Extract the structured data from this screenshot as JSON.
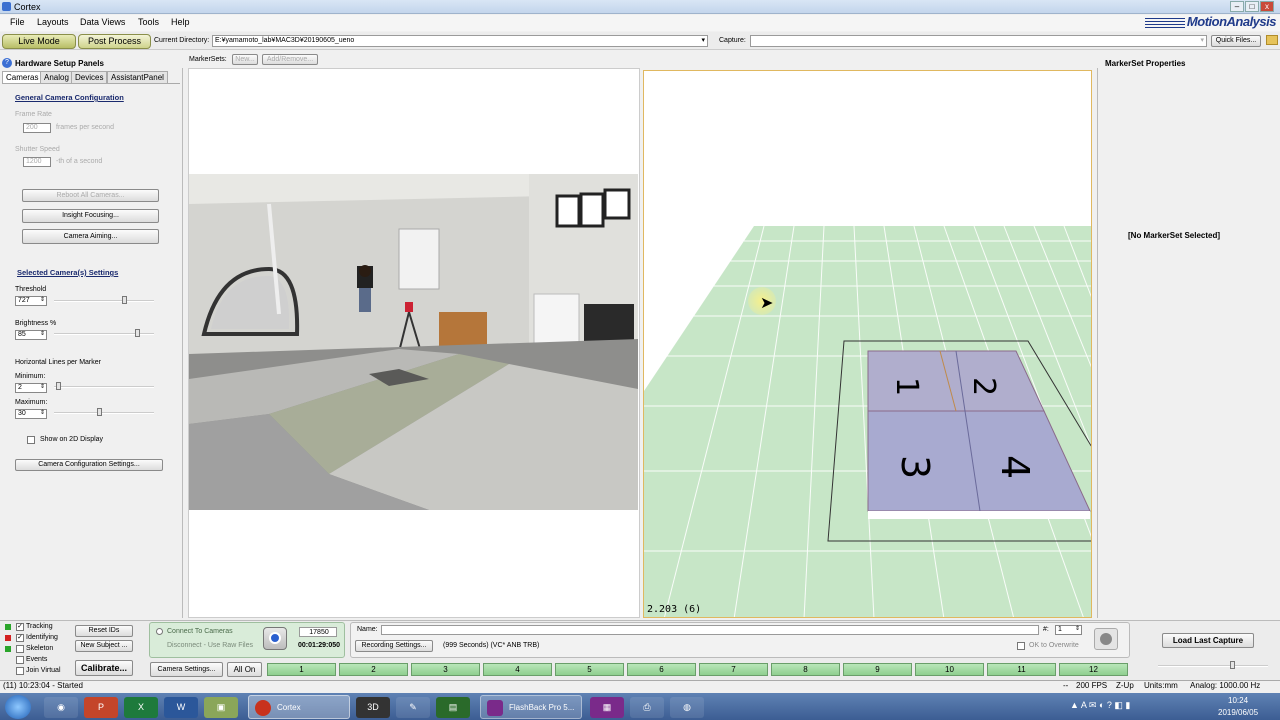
{
  "window": {
    "title": "Cortex",
    "brand": "MotionAnalysis"
  },
  "menu": [
    "File",
    "Layouts",
    "Data Views",
    "Tools",
    "Help"
  ],
  "toolbar": {
    "live_mode": "Live Mode",
    "post_process": "Post Process",
    "current_dir_label": "Current Directory:",
    "current_dir_value": "E:¥yamamoto_lab¥MAC3D¥20190605_ueno",
    "capture_label": "Capture:",
    "capture_value": "",
    "quick_files": "Quick Files..."
  },
  "markersets": {
    "label": "MarkerSets:",
    "new": "New...",
    "add_remove": "Add/Remove..."
  },
  "left": {
    "panel_title": "Hardware Setup Panels",
    "tabs": [
      "Cameras",
      "Analog",
      "Devices",
      "AssistantPanel"
    ],
    "general_title": "General Camera Configuration",
    "frame_rate_label": "Frame Rate",
    "frame_rate_value": "200",
    "frame_rate_unit": "frames per second",
    "shutter_label": "Shutter Speed",
    "shutter_value": "1200",
    "shutter_unit": "-th of a second",
    "reboot": "Reboot All Cameras...",
    "insight": "Insight Focusing...",
    "aiming": "Camera Aiming...",
    "selected_title": "Selected Camera(s) Settings",
    "threshold_label": "Threshold",
    "threshold_value": "727",
    "brightness_label": "Brightness %",
    "brightness_value": "85",
    "hlines_label": "Horizontal Lines per Marker",
    "min_label": "Minimum:",
    "min_value": "2",
    "max_label": "Maximum:",
    "max_value": "30",
    "show2d": "Show on 2D Display",
    "config_settings": "Camera Configuration Settings..."
  },
  "sliders": {
    "threshold": 0.72,
    "brightness": 0.85,
    "minimum": 0.02,
    "maximum": 0.45
  },
  "view3d": {
    "readout": "2.203 (6)",
    "plates": [
      "1",
      "2",
      "3",
      "4"
    ]
  },
  "right": {
    "title": "MarkerSet Properties",
    "empty": "[No MarkerSet Selected]"
  },
  "bottom": {
    "checks": [
      {
        "label": "Tracking",
        "checked": true,
        "color": "#2aa52a"
      },
      {
        "label": "Identifying",
        "checked": true,
        "color": "#d32020"
      },
      {
        "label": "Skeleton",
        "checked": false,
        "color": "#2aa52a"
      },
      {
        "label": "Events",
        "checked": false,
        "color": ""
      },
      {
        "label": "Join Virtual",
        "checked": false,
        "color": ""
      }
    ],
    "reset_ids": "Reset IDs",
    "new_subject": "New Subject ...",
    "calibrate": "Calibrate...",
    "connect": "Connect To Cameras",
    "disconnect": "Disconnect - Use Raw Files",
    "frame_count": "17850",
    "timecode": "00:01:29:050",
    "name_label": "Name:",
    "name_value": "",
    "hash_label": "#:",
    "hash_value": "1",
    "recording_settings": "Recording Settings...",
    "recording_info": "(999 Seconds) (VC* ANB TRB)",
    "ok_overwrite": "OK to Overwrite",
    "load_last": "Load Last Capture",
    "camera_settings": "Camera Settings...",
    "all_on": "All On",
    "cameras": [
      "1",
      "2",
      "3",
      "4",
      "5",
      "6",
      "7",
      "8",
      "9",
      "10",
      "11",
      "12"
    ]
  },
  "status": {
    "left": "(11) 10:23:04 - Started",
    "fps": "200 FPS",
    "zup": "Z-Up",
    "units": "Units:mm",
    "analog": "Analog: 1000.00 Hz",
    "dashes": "--"
  },
  "taskbar": {
    "items": [
      "Cortex",
      "FlashBack Pro 5..."
    ],
    "time": "10:24",
    "date": "2019/06/05"
  }
}
